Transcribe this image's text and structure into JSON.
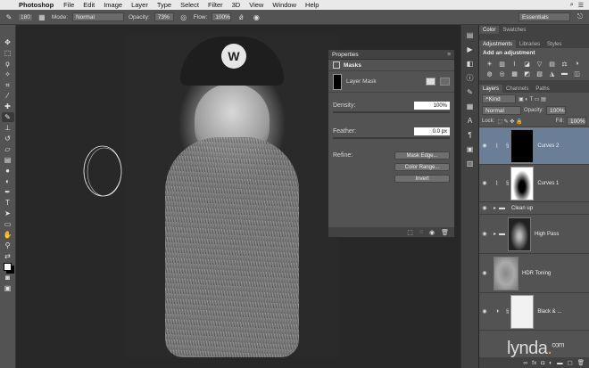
{
  "menubar": {
    "app": "Photoshop",
    "items": [
      "File",
      "Edit",
      "Image",
      "Layer",
      "Type",
      "Select",
      "Filter",
      "3D",
      "View",
      "Window",
      "Help"
    ]
  },
  "options": {
    "brush_size": "180",
    "mode_label": "Mode:",
    "mode_value": "Normal",
    "opacity_label": "Opacity:",
    "opacity_value": "73%",
    "flow_label": "Flow:",
    "flow_value": "100%",
    "workspace": "Essentials"
  },
  "properties": {
    "title": "Properties",
    "section": "Masks",
    "mask_type": "Layer Mask",
    "density_label": "Density:",
    "density_value": "100%",
    "feather_label": "Feather:",
    "feather_value": "0.0 px",
    "refine_label": "Refine:",
    "mask_edge_button": "Mask Edge...",
    "color_range_button": "Color Range...",
    "invert_button": "Invert"
  },
  "right_panel": {
    "top_tabs": [
      "Color",
      "Swatches"
    ],
    "adj_tabs": [
      "Adjustments",
      "Libraries",
      "Styles"
    ],
    "add_adjustment": "Add an adjustment",
    "layer_tabs": [
      "Layers",
      "Channels",
      "Paths"
    ],
    "kind_filter": "Kind",
    "blend_mode": "Normal",
    "opacity_label": "Opacity:",
    "opacity_value": "100%",
    "lock_label": "Lock:",
    "fill_label": "Fill:",
    "fill_value": "100%",
    "layers": [
      {
        "name": "Curves 2"
      },
      {
        "name": "Curves 1"
      },
      {
        "name": "Clean up"
      },
      {
        "name": "High Pass"
      },
      {
        "name": "HDR Toning"
      },
      {
        "name": "Black & ..."
      }
    ]
  },
  "photo": {
    "cap_badge": "W"
  },
  "watermark": {
    "brand": "lynda",
    "dot": ".",
    "tld": "com"
  }
}
